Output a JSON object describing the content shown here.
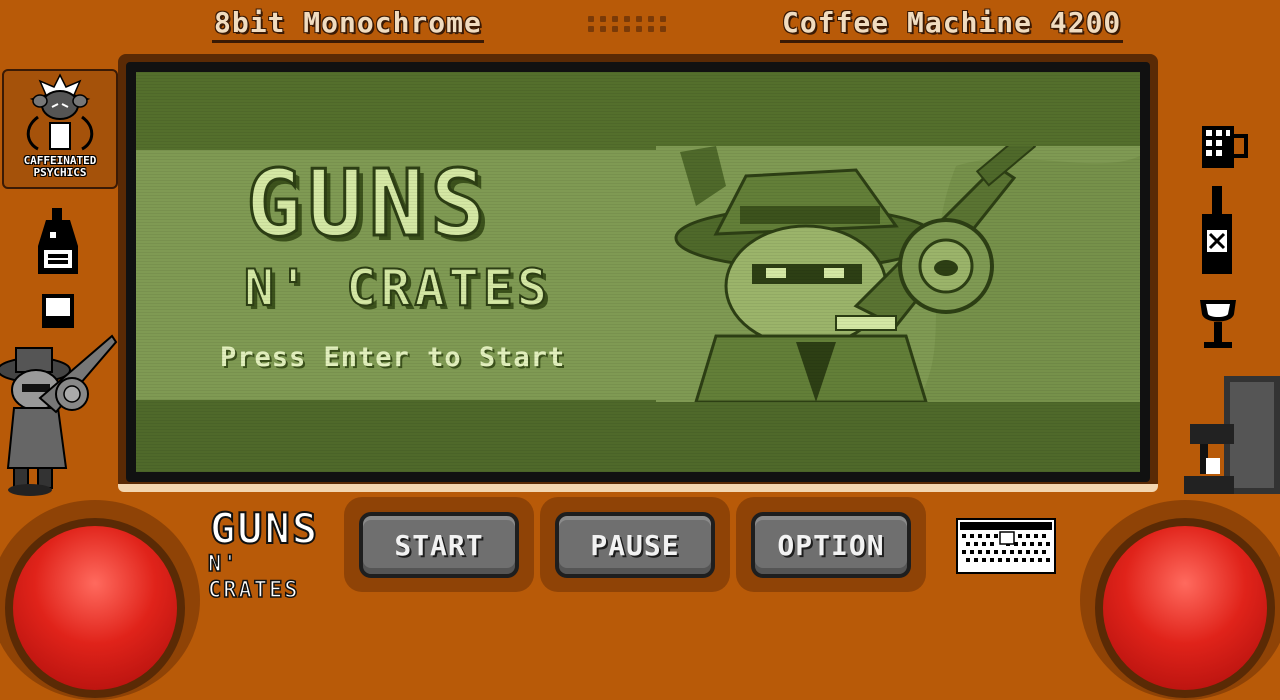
{
  "header": {
    "left_label": "8bit Monochrome",
    "right_label": "Coffee Machine 4200"
  },
  "sidebar_logo": {
    "line1": "CAFFEINATED",
    "line2": "PSYCHICS"
  },
  "game_screen": {
    "title_line1": "GUNS",
    "title_line2": "N' CRATES",
    "prompt": "Press Enter to Start"
  },
  "controls": {
    "logo_line1": "GUNS",
    "logo_line2": "N' CRATES",
    "start_label": "START",
    "pause_label": "PAUSE",
    "option_label": "OPTION"
  },
  "colors": {
    "console_body": "#b85a08",
    "screen_green": "#7f9a53",
    "button_red": "#e0231a",
    "button_gray": "#6f6f6f"
  }
}
